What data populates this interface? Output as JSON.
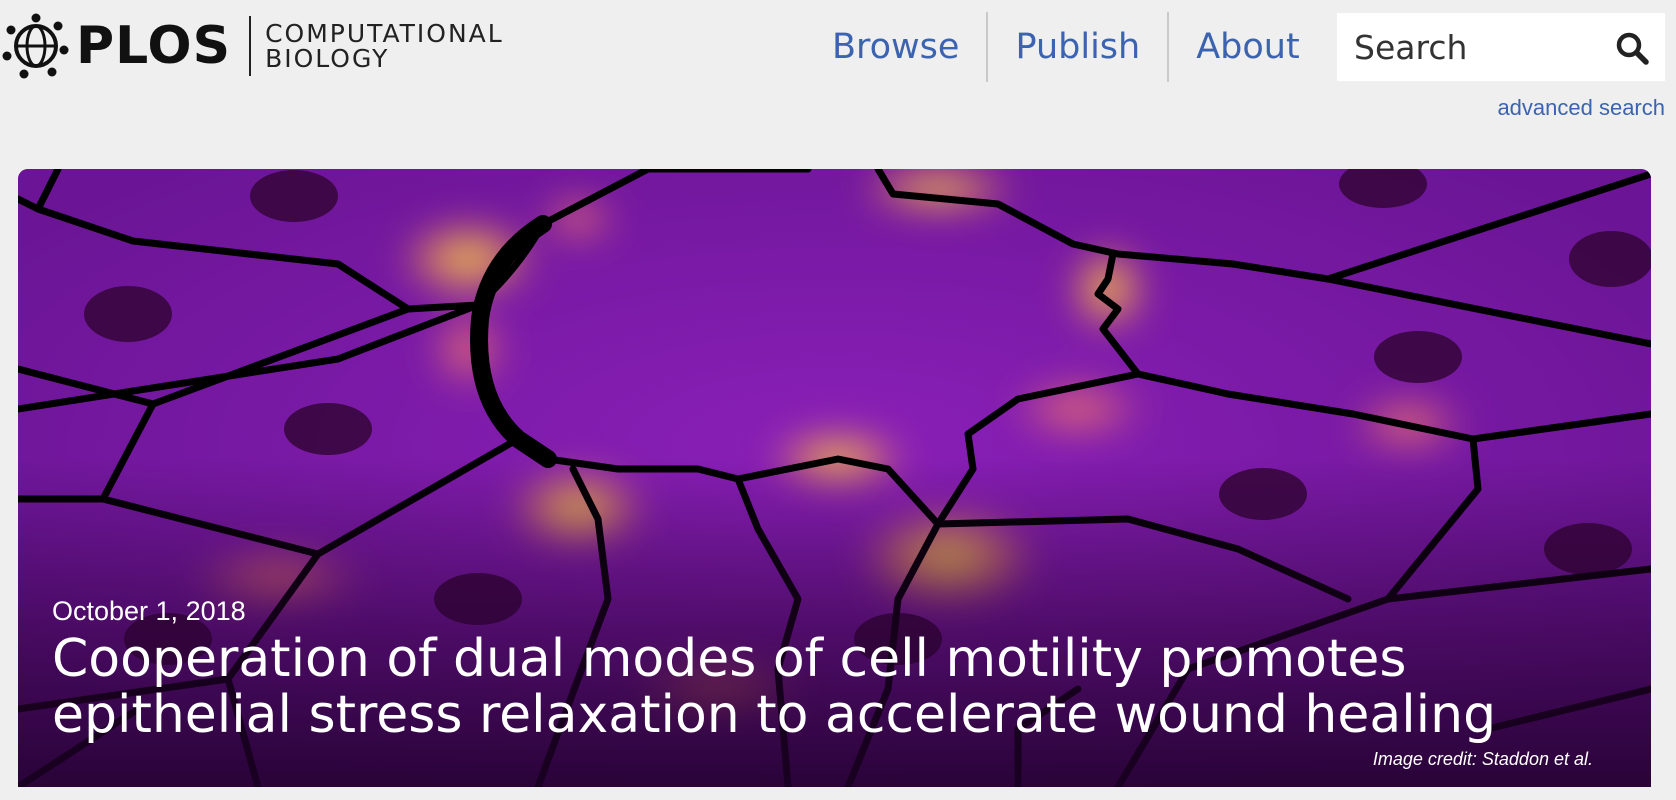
{
  "logo": {
    "wordmark": "PLOS",
    "journal_line1": "COMPUTATIONAL",
    "journal_line2": "BIOLOGY"
  },
  "nav": {
    "items": [
      {
        "label": "Browse"
      },
      {
        "label": "Publish"
      },
      {
        "label": "About"
      }
    ]
  },
  "search": {
    "placeholder": "Search",
    "icon": "search-icon",
    "advanced_label": "advanced search"
  },
  "hero": {
    "date": "October 1, 2018",
    "title": "Cooperation of dual modes of cell motility promotes epithelial stress relaxation to accelerate wound healing",
    "credit": "Image credit: Staddon et al."
  },
  "colors": {
    "background": "#efefef",
    "link": "#3c63af",
    "hero_base": "#7b1fa4",
    "hot_spot": "#f6c94a",
    "cell_border": "#000000"
  }
}
